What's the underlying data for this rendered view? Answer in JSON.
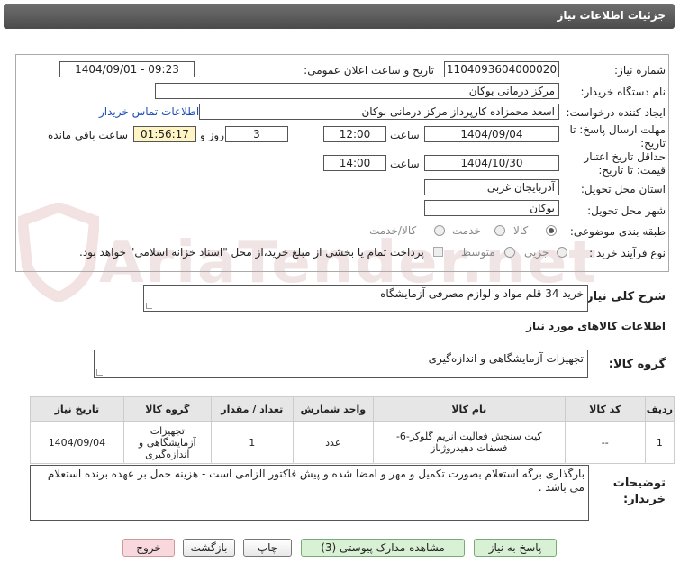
{
  "title": "جزئیات اطلاعات نیاز",
  "fields": {
    "need_number_label": "شماره نیاز:",
    "need_number": "1104093604000020",
    "announce_label": "تاریخ و ساعت اعلان عمومی:",
    "announce_value": "1404/09/01 - 09:23",
    "buyer_label": "نام دستگاه خریدار:",
    "buyer_value": "مرکز درمانی بوکان",
    "creator_label": "ایجاد کننده درخواست:",
    "creator_value": "اسعد محمزاده کارپرداز مرکز درمانی بوکان",
    "contact_link": "اطلاعات تماس خریدار",
    "deadline_label_1": "مهلت ارسال پاسخ: تا",
    "deadline_label_2": "تاریخ:",
    "deadline_date": "1404/09/04",
    "time_label": "ساعت",
    "deadline_time": "12:00",
    "days_value": "3",
    "days_label": "روز و",
    "remaining_time": "01:56:17",
    "remaining_label": "ساعت باقی مانده",
    "validity_label_1": "حداقل تاریخ اعتبار",
    "validity_label_2": "قیمت: تا تاریخ:",
    "validity_date": "1404/10/30",
    "validity_time": "14:00",
    "province_label": "استان محل تحویل:",
    "province_value": "آذربایجان غربی",
    "city_label": "شهر محل تحویل:",
    "city_value": "بوکان",
    "category_label": "طبقه بندی موضوعی:",
    "category_options": [
      "کالا",
      "خدمت",
      "کالا/خدمت"
    ],
    "process_label": "نوع فرآیند خرید :",
    "process_options": [
      "جزیی",
      "متوسط"
    ],
    "payment_note": "پرداخت تمام یا بخشی از مبلغ خرید،از محل \"اسناد خزانه اسلامی\" خواهد بود."
  },
  "summary": {
    "label": "شرح کلی نیاز:",
    "value": "خرید 34 قلم مواد و لوازم مصرفی آزمایشگاه"
  },
  "goods_info_heading": "اطلاعات کالاهای مورد نیاز",
  "goods_group": {
    "label": "گروه کالا:",
    "value": "تجهیزات آزمایشگاهی و اندازه‌گیری"
  },
  "table": {
    "headers": [
      "ردیف",
      "کد کالا",
      "نام کالا",
      "واحد شمارش",
      "تعداد / مقدار",
      "گروه کالا",
      "تاریخ نیاز"
    ],
    "rows": [
      {
        "row": "1",
        "code": "--",
        "name": "کیت سنجش فعالیت آنزیم گلوکز-6-فسفات دهیدروژناز",
        "unit": "عدد",
        "qty": "1",
        "group": "تجهیزات آزمایشگاهی و اندازه‌گیری",
        "date": "1404/09/04"
      }
    ]
  },
  "notes": {
    "label_1": "توضیحات",
    "label_2": "خریدار:",
    "value": "بارگذاری  برگه استعلام بصورت تکمیل و مهر و امضا شده  و پیش فاکتور الزامی است - هزینه حمل بر عهده برنده استعلام می باشد ."
  },
  "buttons": {
    "reply": "پاسخ به نیاز",
    "attachments": "مشاهده مدارک پیوستی (3)",
    "print": "چاپ",
    "back": "بازگشت",
    "exit": "خروج"
  },
  "watermark": "AriaTender.net"
}
